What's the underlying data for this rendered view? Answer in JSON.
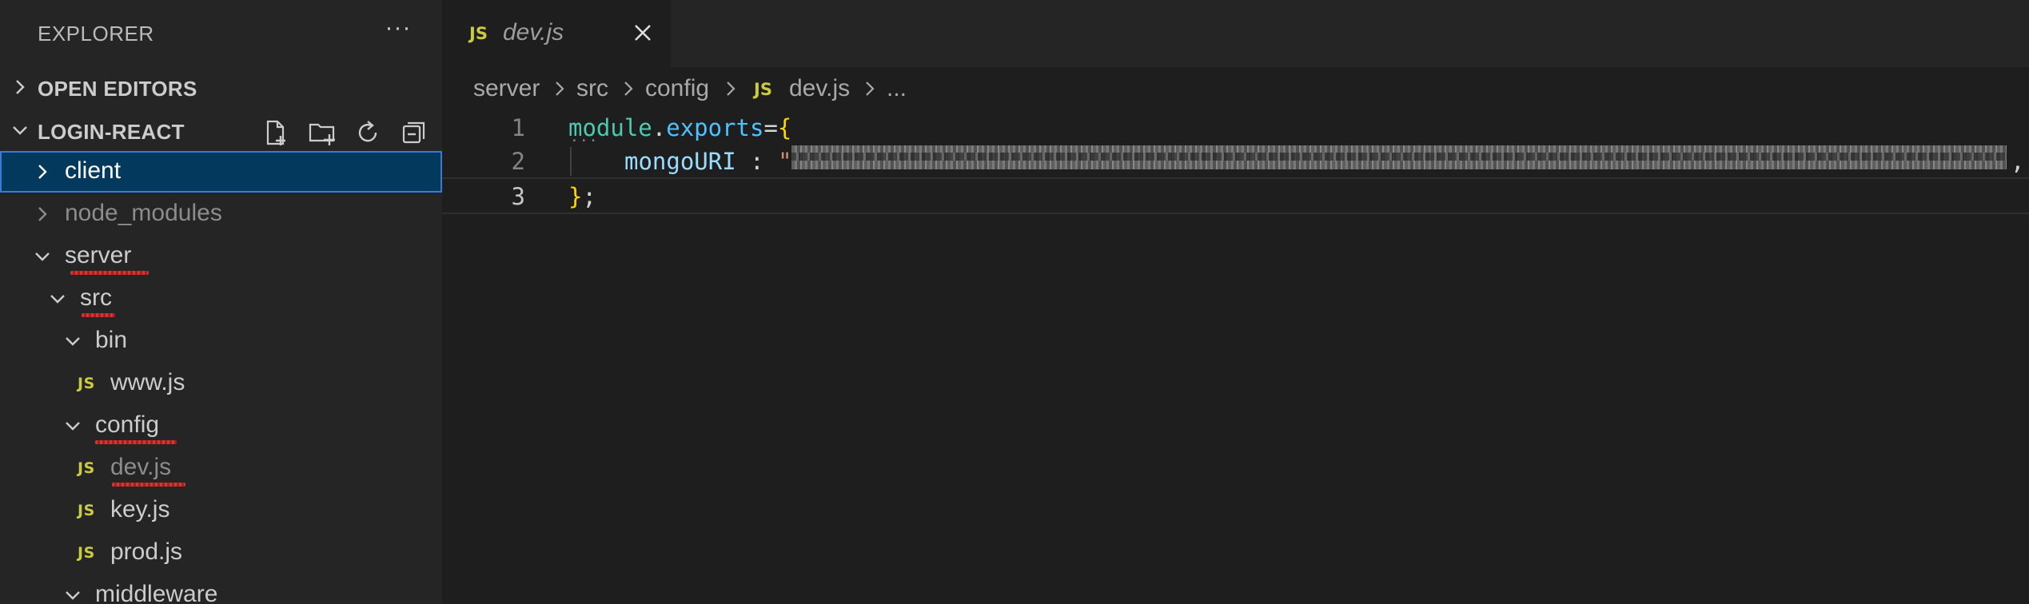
{
  "sidebar": {
    "title": "EXPLORER",
    "more_label": "···",
    "open_editors_label": "OPEN EDITORS",
    "project_label": "LOGIN-REACT",
    "tree": [
      {
        "name": "client"
      },
      {
        "name": "node_modules"
      },
      {
        "name": "server"
      },
      {
        "name": "src"
      },
      {
        "name": "bin"
      },
      {
        "name": "www.js",
        "icon": "JS"
      },
      {
        "name": "config"
      },
      {
        "name": "dev.js",
        "icon": "JS"
      },
      {
        "name": "key.js",
        "icon": "JS"
      },
      {
        "name": "prod.js",
        "icon": "JS"
      },
      {
        "name": "middleware"
      }
    ]
  },
  "editor": {
    "tab": {
      "icon": "JS",
      "label": "dev.js"
    },
    "breadcrumb": {
      "items": [
        "server",
        "src",
        "config",
        "dev.js",
        "..."
      ],
      "file_icon": "JS"
    },
    "lines": [
      {
        "number": "1",
        "tokens": {
          "module": "module",
          "dot": ".",
          "exports": "exports",
          "eq": "=",
          "brace": "{"
        }
      },
      {
        "number": "2",
        "tokens": {
          "key": "mongoURI",
          "colon": " : ",
          "quote": "\"",
          "end": ","
        }
      },
      {
        "number": "3",
        "tokens": {
          "brace": "}",
          "semi": ";"
        }
      }
    ]
  },
  "colors": {
    "accent_selected": "#04395e",
    "js_icon": "#cbcb41",
    "squiggle": "#e53935"
  }
}
